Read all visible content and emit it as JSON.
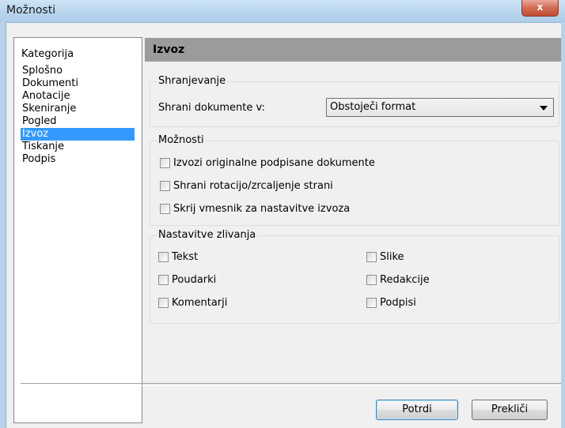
{
  "window": {
    "title": "Možnosti",
    "close_label": "x"
  },
  "category": {
    "header": "Kategorija",
    "items": [
      "Splošno",
      "Dokumenti",
      "Anotacije",
      "Skeniranje",
      "Pogled",
      "Izvoz",
      "Tiskanje",
      "Podpis"
    ],
    "selected": "Izvoz"
  },
  "section": {
    "title": "Izvoz"
  },
  "save_group": {
    "legend": "Shranjevanje",
    "label": "Shrani dokumente v:",
    "select_value": "Obstoječi format"
  },
  "options_group": {
    "legend": "Možnosti",
    "items": [
      {
        "label": "Izvozi originalne podpisane dokumente",
        "checked": false
      },
      {
        "label": "Shrani rotacijo/zrcaljenje strani",
        "checked": false
      },
      {
        "label": "Skrij vmesnik za nastavitve izvoza",
        "checked": false
      }
    ]
  },
  "merge_group": {
    "legend": "Nastavitve zlivanja",
    "left": [
      {
        "label": "Tekst",
        "checked": false
      },
      {
        "label": "Poudarki",
        "checked": false
      },
      {
        "label": "Komentarji",
        "checked": false
      }
    ],
    "right": [
      {
        "label": "Slike",
        "checked": false
      },
      {
        "label": "Redakcije",
        "checked": false
      },
      {
        "label": "Podpisi",
        "checked": false
      }
    ]
  },
  "buttons": {
    "ok": "Potrdi",
    "cancel": "Prekliči"
  }
}
